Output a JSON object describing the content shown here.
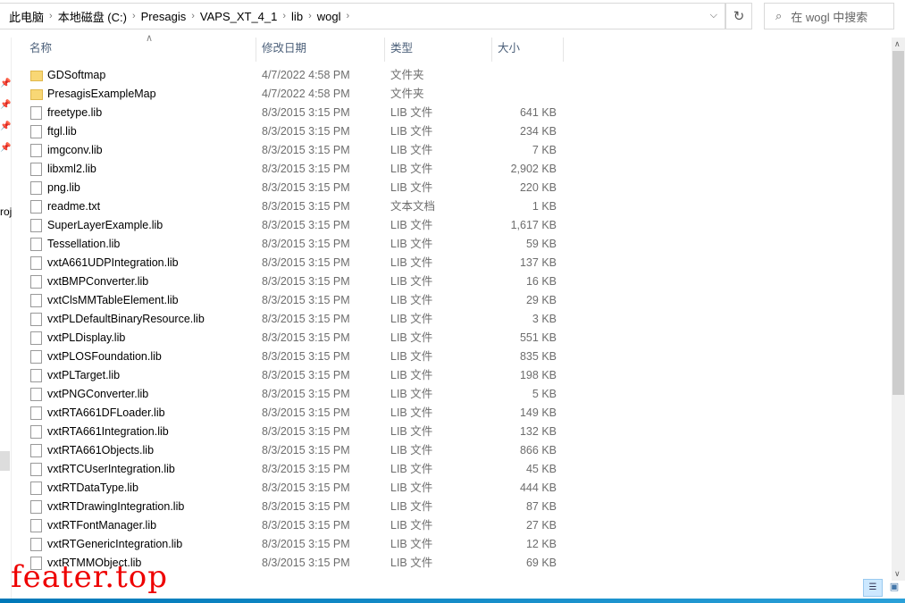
{
  "address": {
    "crumbs": [
      "此电脑",
      "本地磁盘 (C:)",
      "Presagis",
      "VAPS_XT_4_1",
      "lib",
      "wogl"
    ]
  },
  "search": {
    "placeholder": "在 wogl 中搜索"
  },
  "nav": {
    "partial_label": "roj"
  },
  "columns": {
    "name": "名称",
    "date": "修改日期",
    "type": "类型",
    "size": "大小"
  },
  "files": [
    {
      "name": "GDSoftmap",
      "date": "4/7/2022 4:58 PM",
      "type": "文件夹",
      "size": "",
      "kind": "folder"
    },
    {
      "name": "PresagisExampleMap",
      "date": "4/7/2022 4:58 PM",
      "type": "文件夹",
      "size": "",
      "kind": "folder"
    },
    {
      "name": "freetype.lib",
      "date": "8/3/2015 3:15 PM",
      "type": "LIB 文件",
      "size": "641 KB",
      "kind": "file"
    },
    {
      "name": "ftgl.lib",
      "date": "8/3/2015 3:15 PM",
      "type": "LIB 文件",
      "size": "234 KB",
      "kind": "file"
    },
    {
      "name": "imgconv.lib",
      "date": "8/3/2015 3:15 PM",
      "type": "LIB 文件",
      "size": "7 KB",
      "kind": "file"
    },
    {
      "name": "libxml2.lib",
      "date": "8/3/2015 3:15 PM",
      "type": "LIB 文件",
      "size": "2,902 KB",
      "kind": "file"
    },
    {
      "name": "png.lib",
      "date": "8/3/2015 3:15 PM",
      "type": "LIB 文件",
      "size": "220 KB",
      "kind": "file"
    },
    {
      "name": "readme.txt",
      "date": "8/3/2015 3:15 PM",
      "type": "文本文档",
      "size": "1 KB",
      "kind": "file"
    },
    {
      "name": "SuperLayerExample.lib",
      "date": "8/3/2015 3:15 PM",
      "type": "LIB 文件",
      "size": "1,617 KB",
      "kind": "file"
    },
    {
      "name": "Tessellation.lib",
      "date": "8/3/2015 3:15 PM",
      "type": "LIB 文件",
      "size": "59 KB",
      "kind": "file"
    },
    {
      "name": "vxtA661UDPIntegration.lib",
      "date": "8/3/2015 3:15 PM",
      "type": "LIB 文件",
      "size": "137 KB",
      "kind": "file"
    },
    {
      "name": "vxtBMPConverter.lib",
      "date": "8/3/2015 3:15 PM",
      "type": "LIB 文件",
      "size": "16 KB",
      "kind": "file"
    },
    {
      "name": "vxtClsMMTableElement.lib",
      "date": "8/3/2015 3:15 PM",
      "type": "LIB 文件",
      "size": "29 KB",
      "kind": "file"
    },
    {
      "name": "vxtPLDefaultBinaryResource.lib",
      "date": "8/3/2015 3:15 PM",
      "type": "LIB 文件",
      "size": "3 KB",
      "kind": "file"
    },
    {
      "name": "vxtPLDisplay.lib",
      "date": "8/3/2015 3:15 PM",
      "type": "LIB 文件",
      "size": "551 KB",
      "kind": "file"
    },
    {
      "name": "vxtPLOSFoundation.lib",
      "date": "8/3/2015 3:15 PM",
      "type": "LIB 文件",
      "size": "835 KB",
      "kind": "file"
    },
    {
      "name": "vxtPLTarget.lib",
      "date": "8/3/2015 3:15 PM",
      "type": "LIB 文件",
      "size": "198 KB",
      "kind": "file"
    },
    {
      "name": "vxtPNGConverter.lib",
      "date": "8/3/2015 3:15 PM",
      "type": "LIB 文件",
      "size": "5 KB",
      "kind": "file"
    },
    {
      "name": "vxtRTA661DFLoader.lib",
      "date": "8/3/2015 3:15 PM",
      "type": "LIB 文件",
      "size": "149 KB",
      "kind": "file"
    },
    {
      "name": "vxtRTA661Integration.lib",
      "date": "8/3/2015 3:15 PM",
      "type": "LIB 文件",
      "size": "132 KB",
      "kind": "file"
    },
    {
      "name": "vxtRTA661Objects.lib",
      "date": "8/3/2015 3:15 PM",
      "type": "LIB 文件",
      "size": "866 KB",
      "kind": "file"
    },
    {
      "name": "vxtRTCUserIntegration.lib",
      "date": "8/3/2015 3:15 PM",
      "type": "LIB 文件",
      "size": "45 KB",
      "kind": "file"
    },
    {
      "name": "vxtRTDataType.lib",
      "date": "8/3/2015 3:15 PM",
      "type": "LIB 文件",
      "size": "444 KB",
      "kind": "file"
    },
    {
      "name": "vxtRTDrawingIntegration.lib",
      "date": "8/3/2015 3:15 PM",
      "type": "LIB 文件",
      "size": "87 KB",
      "kind": "file"
    },
    {
      "name": "vxtRTFontManager.lib",
      "date": "8/3/2015 3:15 PM",
      "type": "LIB 文件",
      "size": "27 KB",
      "kind": "file"
    },
    {
      "name": "vxtRTGenericIntegration.lib",
      "date": "8/3/2015 3:15 PM",
      "type": "LIB 文件",
      "size": "12 KB",
      "kind": "file"
    },
    {
      "name": "vxtRTMMObject.lib",
      "date": "8/3/2015 3:15 PM",
      "type": "LIB 文件",
      "size": "69 KB",
      "kind": "file"
    }
  ],
  "watermark": "feater.top"
}
